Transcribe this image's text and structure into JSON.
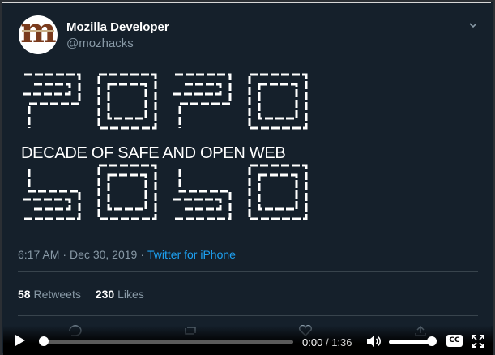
{
  "tweet": {
    "author_name": "Mozilla Developer",
    "author_handle": "@mozhacks",
    "avatar_letter": "m",
    "media_graphic": {
      "top_text": "2020",
      "bottom_text": "2020",
      "caption": "DECADE OF SAFE AND OPEN WEB"
    },
    "time": "6:17 AM",
    "date": "Dec 30, 2019",
    "separator": "·",
    "source": "Twitter for iPhone",
    "retweet_count": "58",
    "retweet_label": "Retweets",
    "like_count": "230",
    "like_label": "Likes"
  },
  "player": {
    "current_time": "0:00",
    "time_separator": "/",
    "duration": "1:36",
    "progress_fraction": 0.0,
    "volume_fraction": 0.95,
    "cc_label": "CC"
  },
  "icons": {
    "caret": "chevron-down-icon",
    "play": "play-icon",
    "volume": "volume-icon",
    "fullscreen": "fullscreen-icon"
  },
  "colors": {
    "background": "#15202b",
    "secondary_text": "#8899a6",
    "link": "#1da1f2"
  }
}
